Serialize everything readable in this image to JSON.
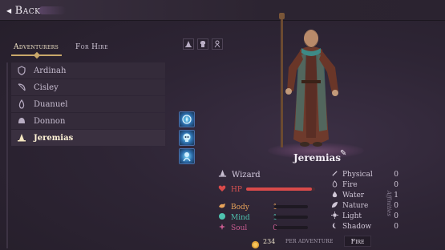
{
  "topbar": {
    "back_label": "Back"
  },
  "tabs": [
    {
      "label": "Adventurers",
      "active": true
    },
    {
      "label": "For Hire",
      "active": false
    }
  ],
  "filters": [
    "wizard-hat-icon",
    "armor-icon",
    "person-icon"
  ],
  "adventurers": [
    {
      "name": "Ardinah",
      "icon": "shield-icon",
      "selected": false
    },
    {
      "name": "Cisley",
      "icon": "bow-icon",
      "selected": false
    },
    {
      "name": "Duanuel",
      "icon": "flame-icon",
      "selected": false
    },
    {
      "name": "Donnon",
      "icon": "helmet-icon",
      "selected": false
    },
    {
      "name": "Jeremias",
      "icon": "wizard-hat-icon",
      "selected": true
    }
  ],
  "skills": [
    "compass-skill-icon",
    "skull-skill-icon",
    "spirit-skill-icon"
  ],
  "character": {
    "name": "Jeremias",
    "class": "Wizard",
    "hp_label": "HP",
    "hp_fraction": 0.95
  },
  "stats": [
    {
      "label": "Body",
      "value": "1",
      "color": "#e8a35a"
    },
    {
      "label": "Mind",
      "value": "1",
      "color": "#4fc3b0"
    },
    {
      "label": "Soul",
      "value": "0",
      "color": "#c85b8f"
    }
  ],
  "affinities_label": "Affinities",
  "affinities": [
    {
      "label": "Physical",
      "value": "0",
      "icon": "sword-icon"
    },
    {
      "label": "Fire",
      "value": "0",
      "icon": "fire-icon"
    },
    {
      "label": "Water",
      "value": "1",
      "icon": "water-drop-icon"
    },
    {
      "label": "Nature",
      "value": "0",
      "icon": "leaf-icon"
    },
    {
      "label": "Light",
      "value": "0",
      "icon": "sun-icon"
    },
    {
      "label": "Shadow",
      "value": "0",
      "icon": "moon-icon"
    }
  ],
  "footer": {
    "cost": "234",
    "per_adventure": "PER ADVENTURE",
    "fire_label": "Fire"
  },
  "colors": {
    "accent_gold": "#c9a86a",
    "hp_red": "#d94a4a",
    "background": "#2b2330"
  }
}
